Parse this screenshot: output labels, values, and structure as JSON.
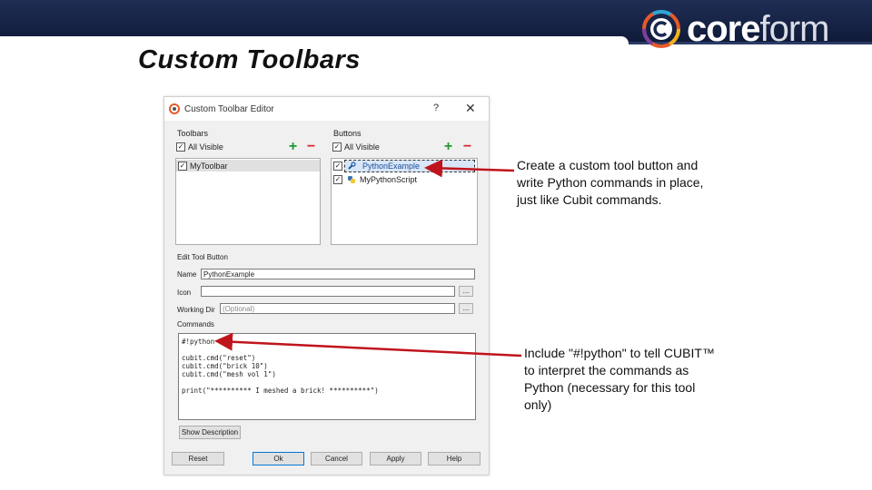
{
  "slide": {
    "title": "Custom Toolbars",
    "logo_text_bold": "core",
    "logo_text_light": "form"
  },
  "dialog": {
    "title": "Custom Toolbar Editor",
    "help_glyph": "?",
    "close_glyph": "✕",
    "toolbars": {
      "label": "Toolbars",
      "all_visible": "All Visible",
      "all_visible_checked": true,
      "items": [
        {
          "label": "MyToolbar",
          "checked": true
        }
      ]
    },
    "buttons": {
      "label": "Buttons",
      "all_visible": "All Visible",
      "all_visible_checked": true,
      "items": [
        {
          "label": "PythonExample",
          "checked": true
        },
        {
          "label": "MyPythonScript",
          "checked": true
        }
      ]
    },
    "edit_tool_button": {
      "label": "Edit Tool Button",
      "name_label": "Name",
      "name_value": "PythonExample",
      "icon_label": "Icon",
      "icon_value": "",
      "working_dir_label": "Working Dir",
      "working_dir_placeholder": "(Optional)",
      "browse_label": "...",
      "commands_label": "Commands",
      "commands": [
        "#!python",
        "",
        "cubit.cmd(\"reset\")",
        "cubit.cmd(\"brick 10\")",
        "cubit.cmd(\"mesh vol 1\")",
        "",
        "print(\"********** I meshed a brick! **********\")"
      ],
      "show_description": "Show Description"
    },
    "footer": {
      "reset": "Reset",
      "ok": "Ok",
      "cancel": "Cancel",
      "apply": "Apply",
      "help": "Help"
    }
  },
  "callouts": {
    "first": [
      "Create a custom tool button and",
      "write Python commands in place,",
      "just like Cubit commands."
    ],
    "second": [
      "Include \"#!python\" to tell CUBIT™",
      "to interpret the commands as",
      "Python (necessary for this tool",
      "only)"
    ]
  },
  "colors": {
    "header_bg": "#1a2850",
    "arrow": "#c0141c",
    "plus": "#1e9b32",
    "minus": "#d4282a"
  }
}
